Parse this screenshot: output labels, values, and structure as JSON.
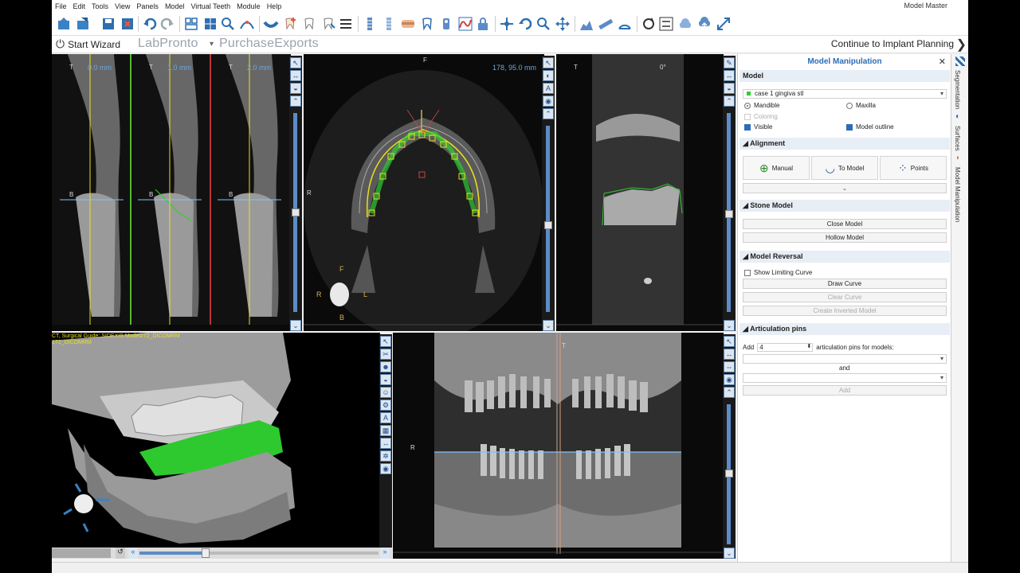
{
  "menu": [
    "File",
    "Edit",
    "Tools",
    "View",
    "Panels",
    "Model",
    "Virtual Teeth",
    "Module",
    "Help"
  ],
  "app_title": "Model Master",
  "subbar": {
    "start_wizard": "Start Wizard",
    "brand1": "LabPronto",
    "brand2": "PurchaseExports",
    "continue": "Continue to Implant Planning"
  },
  "views": {
    "cross1": {
      "top": "T",
      "label": "0.0 mm",
      "mid": "B"
    },
    "cross2": {
      "top": "T",
      "label": "1.0 mm",
      "mid": "B"
    },
    "cross3": {
      "top": "T",
      "label": "2.0 mm",
      "mid": "B"
    },
    "axial": {
      "coord": "178, 95.0 mm",
      "top": "F",
      "left": "R",
      "r2": "R",
      "l": "L",
      "f": "F",
      "b": "B"
    },
    "sagittal": {
      "top": "T",
      "angle": "0°"
    },
    "volume": {
      "caption1": "CT, Surgical Guide: SIDEXIS Model272_DICOMRM",
      "caption2": "272_DICOMRM"
    },
    "pano": {
      "top": "T",
      "r": "R"
    }
  },
  "panel": {
    "title": "Model Manipulation",
    "model_section": "Model",
    "model_select": "case 1 gingiva stl",
    "mandible": "Mandible",
    "maxilla": "Maxilla",
    "coloring": "Coloring",
    "visible": "Visible",
    "model_outline": "Model outline",
    "alignment_section": "Alignment",
    "manual": "Manual",
    "to_model": "To Model",
    "points": "Points",
    "stone_section": "Stone Model",
    "close_model": "Close Model",
    "hollow_model": "Hollow Model",
    "reversal_section": "Model Reversal",
    "show_limiting": "Show Limiting Curve",
    "draw_curve": "Draw Curve",
    "clear_curve": "Clear Curve",
    "create_inverted": "Create Inverted Model",
    "pins_section": "Articulation pins",
    "add_label": "Add",
    "pins_value": "4",
    "pins_suffix": "articulation pins for models:",
    "and": "and",
    "add_button": "Add"
  },
  "sidetabs": [
    "Segmentation",
    "Surfaces",
    "Model Manipulation"
  ],
  "colors": {
    "accent": "#2c6db5",
    "gingiva": "#33cc33",
    "yellow": "#e8e020"
  }
}
